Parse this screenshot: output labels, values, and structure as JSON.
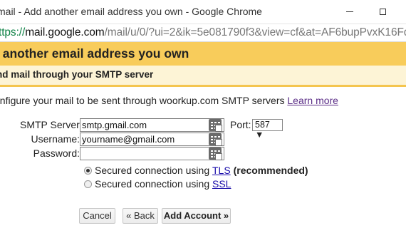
{
  "window": {
    "title": "mail - Add another email address you own - Google Chrome",
    "minimize_icon": "minimize-icon",
    "maximize_icon": "maximize-icon"
  },
  "address_bar": {
    "scheme": "ttps://",
    "host": "mail.google.com",
    "path": "/mail/u/0/?ui=2&ik=5e081790f3&view=cf&at=AF6bupPvxK16FdVC"
  },
  "dialog": {
    "header": "l another email address you own",
    "subheader": "nd mail through your SMTP server",
    "intro_text": "onfigure your mail to be sent through woorkup.com SMTP servers ",
    "learn_more": "Learn more"
  },
  "form": {
    "smtp_label": "SMTP Server:",
    "smtp_value": "smtp.gmail.com",
    "port_label": "Port:",
    "port_value": "587 ▼",
    "username_label": "Username:",
    "username_value": "yourname@gmail.com",
    "password_label": "Password:",
    "password_value": ""
  },
  "security": {
    "tls_prefix": "Secured connection using ",
    "tls_link": "TLS",
    "tls_suffix": " (recommended)",
    "tls_checked": true,
    "ssl_prefix": "Secured connection using ",
    "ssl_link": "SSL",
    "ssl_checked": false
  },
  "buttons": {
    "cancel": "Cancel",
    "back": "« Back",
    "add": "Add Account »"
  }
}
